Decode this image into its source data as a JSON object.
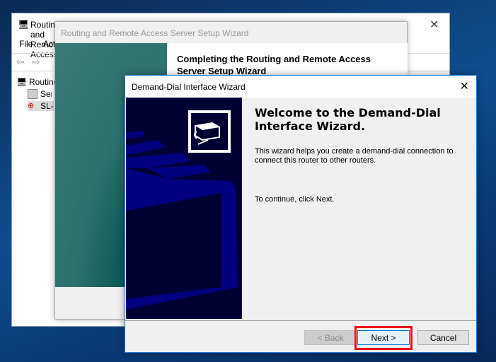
{
  "mmc": {
    "title": "Routing and Remote Access",
    "menu": [
      "File",
      "Action"
    ],
    "tree": [
      "Routing and Remote Access",
      "Server Status",
      "SL-"
    ]
  },
  "setup_wizard": {
    "title": "Routing and Remote Access Server Setup Wizard",
    "heading": "Completing the Routing and Remote Access Server Setup Wizard"
  },
  "dialog": {
    "title": "Demand-Dial Interface Wizard",
    "heading": "Welcome to the Demand-Dial Interface Wizard.",
    "description": "This wizard helps you create a demand-dial connection to connect this router to other routers.",
    "continue_text": "To continue, click Next.",
    "buttons": {
      "back": "< Back",
      "next": "Next >",
      "cancel": "Cancel"
    }
  },
  "colors": {
    "highlight": "#e8141c",
    "accent": "#0078d7"
  }
}
